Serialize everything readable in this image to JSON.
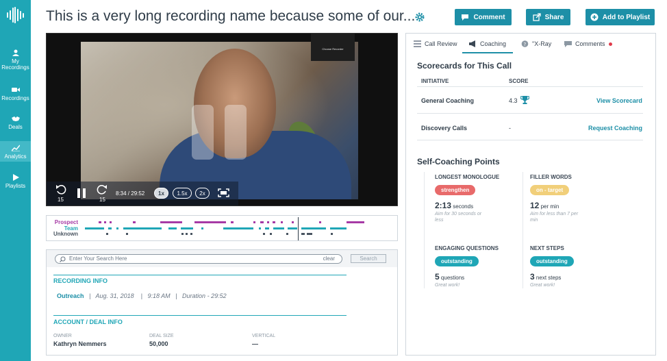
{
  "sidebar": {
    "items": [
      {
        "label_line1": "My",
        "label_line2": "Recordings",
        "icon": "user-icon"
      },
      {
        "label_line1": "Recordings",
        "label_line2": "",
        "icon": "video-camera-icon"
      },
      {
        "label_line1": "Deals",
        "label_line2": "",
        "icon": "handshake-icon"
      },
      {
        "label_line1": "Analytics",
        "label_line2": "",
        "icon": "chart-icon",
        "active": true
      },
      {
        "label_line1": "Playlists",
        "label_line2": "",
        "icon": "play-icon"
      }
    ]
  },
  "header": {
    "title": "This is a very long recording name because some of our...",
    "comment_label": "Comment",
    "share_label": "Share",
    "playlist_label": "Add to Playlist"
  },
  "video": {
    "camera_label": "Choose Recorder",
    "rewind_seconds": "15",
    "forward_seconds": "15",
    "time": "8:34 / 29:52",
    "speeds": [
      "1x",
      "1.5x",
      "2x"
    ],
    "selected_speed": "1x"
  },
  "timeline": {
    "labels": [
      "Prospect",
      "Team",
      "Unknown"
    ],
    "colors": {
      "Prospect": "#a63aa5",
      "Team": "#1fa6b6",
      "Unknown": "#4a5561"
    },
    "playhead_progress": 0.34
  },
  "search": {
    "placeholder": "Enter Your Search Here",
    "clear_label": "clear",
    "button_label": "Search"
  },
  "recording_info": {
    "heading": "RECORDING INFO",
    "source": "Outreach",
    "date": "Aug. 31, 2018",
    "time": "9:18 AM",
    "duration": "Duration - 29:52",
    "sep": "|"
  },
  "account_info": {
    "heading": "ACCOUNT / DEAL INFO",
    "owner_label": "OWNER",
    "owner_value": "Kathryn Nemmers",
    "deal_size_label": "DEAL SIZE",
    "deal_size_value": "50,000",
    "vertical_label": "VERTICAL",
    "vertical_value": "—"
  },
  "tabs": [
    {
      "label": "Call Review",
      "icon": "list-icon"
    },
    {
      "label": "Coaching",
      "icon": "megaphone-icon",
      "active": true
    },
    {
      "label": "\"X-Ray",
      "icon": "question-circle-icon"
    },
    {
      "label": "Comments",
      "icon": "speech-bubble-icon",
      "has_notification": true
    }
  ],
  "scorecards": {
    "heading": "Scorecards for This Call",
    "col_initiative": "INITIATIVE",
    "col_score": "SCORE",
    "rows": [
      {
        "initiative": "General Coaching",
        "score": "4.3",
        "action": "View Scorecard",
        "trophy": true
      },
      {
        "initiative": "Discovery Calls",
        "score": "-",
        "action": "Request Coaching",
        "trophy": false
      }
    ]
  },
  "self_coaching": {
    "heading": "Self-Coaching Points",
    "points": [
      {
        "label": "LONGEST MONOLOGUE",
        "badge": "strengthen",
        "badge_color": "#e86a6a",
        "value": "2:13",
        "unit": "seconds",
        "note": "Aim for 30 seconds or less"
      },
      {
        "label": "FILLER WORDS",
        "badge": "on - target",
        "badge_color": "#f1cf7a",
        "value": "12",
        "unit": "per min",
        "note": "Aim for less than 7 per min"
      },
      {
        "label": "ENGAGING QUESTIONS",
        "badge": "outstanding",
        "badge_color": "#1fa6b6",
        "value": "5",
        "unit": "questions",
        "note": "Great work!"
      },
      {
        "label": "NEXT STEPS",
        "badge": "outstanding",
        "badge_color": "#1fa6b6",
        "value": "3",
        "unit": "next steps",
        "note": "Great work!"
      }
    ]
  }
}
